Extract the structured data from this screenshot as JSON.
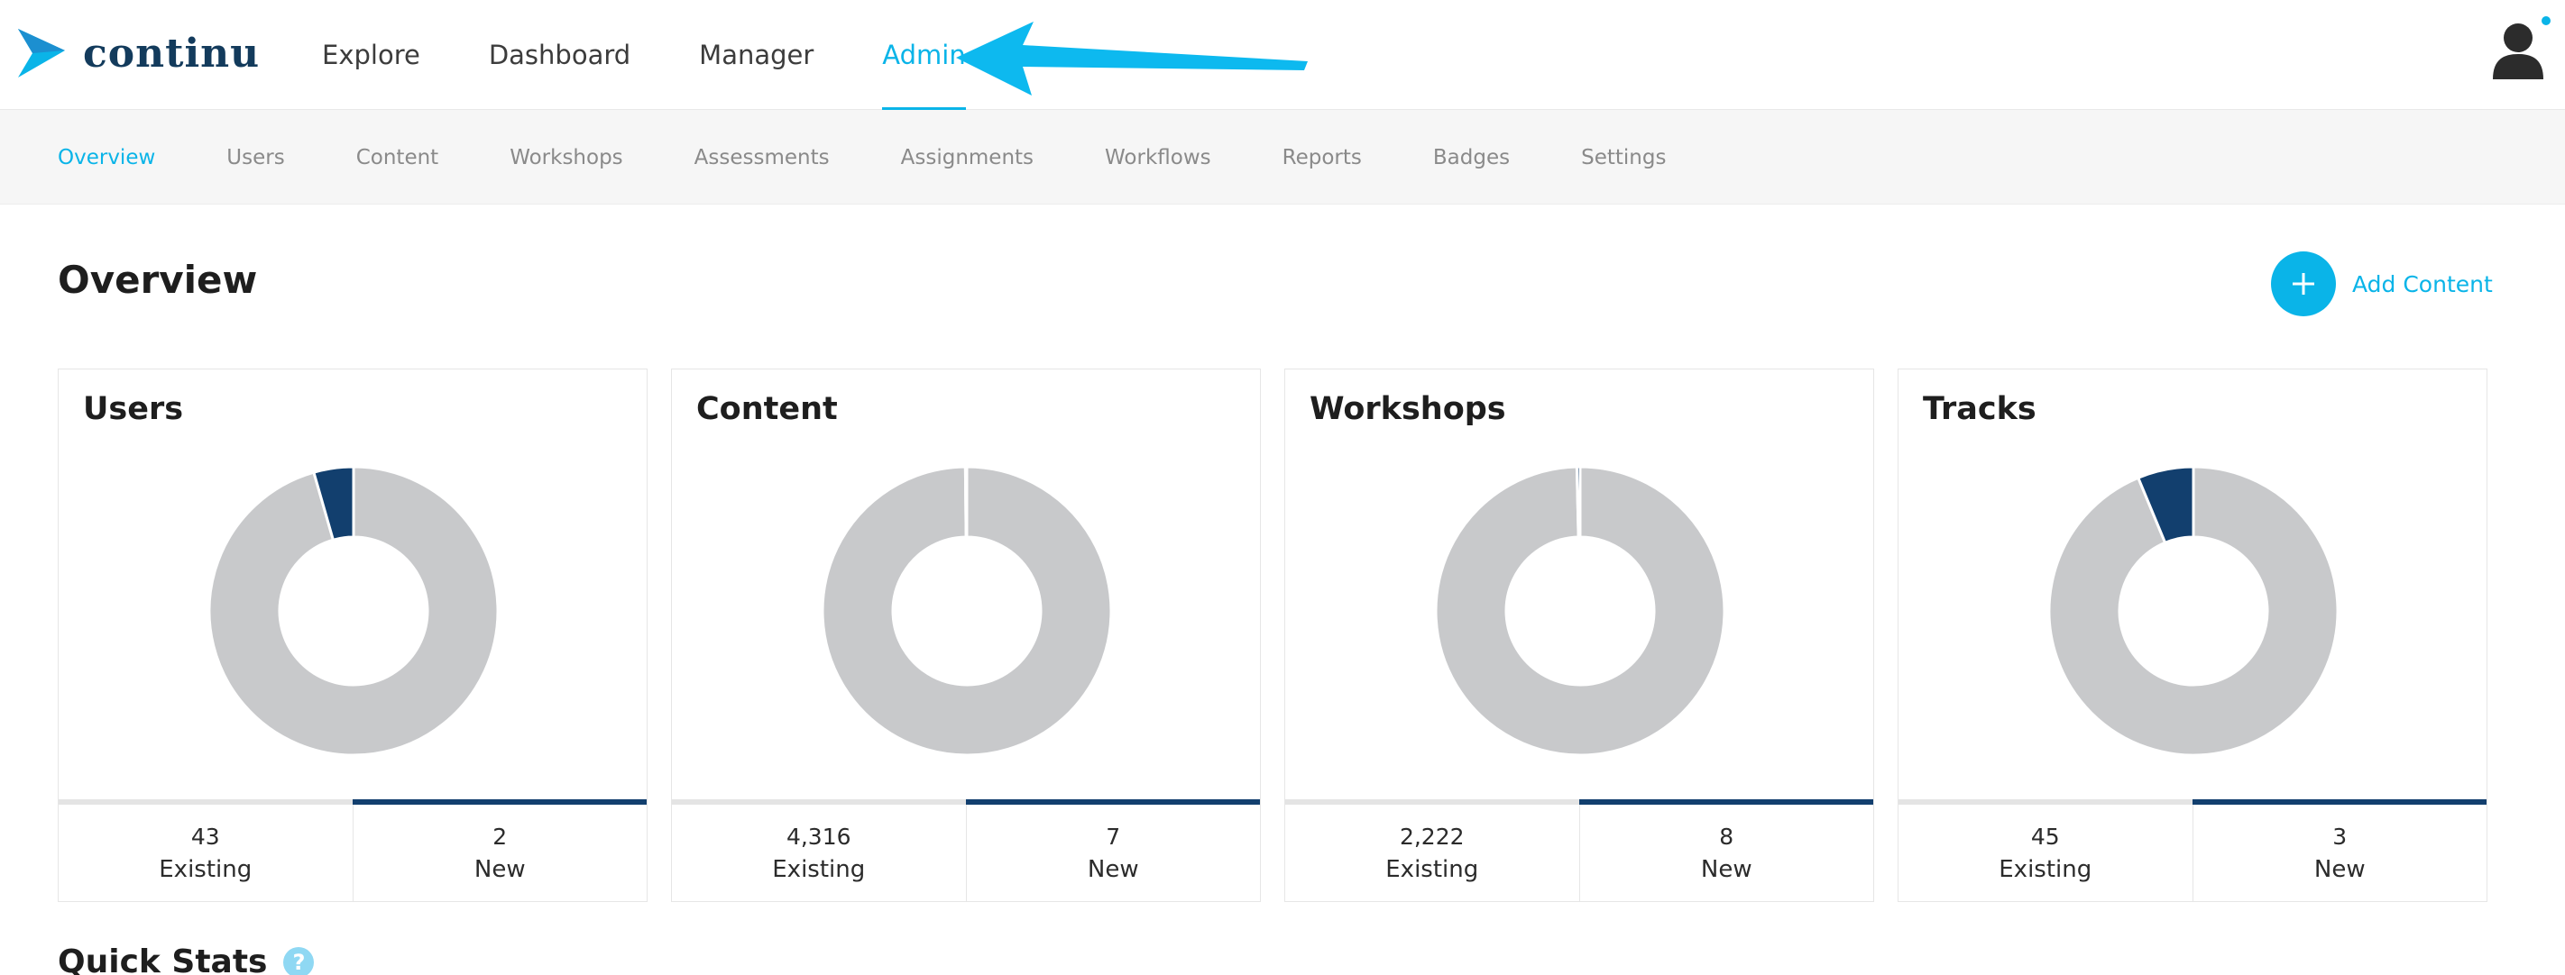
{
  "brand": {
    "name": "continu",
    "color": "#133b5c",
    "accent": "#0ab4e8"
  },
  "topnav": {
    "items": [
      {
        "label": "Explore",
        "active": false
      },
      {
        "label": "Dashboard",
        "active": false
      },
      {
        "label": "Manager",
        "active": false
      },
      {
        "label": "Admin",
        "active": true
      }
    ]
  },
  "subnav": {
    "items": [
      {
        "label": "Overview",
        "active": true
      },
      {
        "label": "Users",
        "active": false
      },
      {
        "label": "Content",
        "active": false
      },
      {
        "label": "Workshops",
        "active": false
      },
      {
        "label": "Assessments",
        "active": false
      },
      {
        "label": "Assignments",
        "active": false
      },
      {
        "label": "Workflows",
        "active": false
      },
      {
        "label": "Reports",
        "active": false
      },
      {
        "label": "Badges",
        "active": false
      },
      {
        "label": "Settings",
        "active": false
      }
    ]
  },
  "page": {
    "title": "Overview",
    "add_content_label": "Add Content"
  },
  "cards": [
    {
      "title": "Users",
      "existing_value": "43",
      "existing_label": "Existing",
      "new_value": "2",
      "new_label": "New",
      "existing": 43,
      "new": 2
    },
    {
      "title": "Content",
      "existing_value": "4,316",
      "existing_label": "Existing",
      "new_value": "7",
      "new_label": "New",
      "existing": 4316,
      "new": 7
    },
    {
      "title": "Workshops",
      "existing_value": "2,222",
      "existing_label": "Existing",
      "new_value": "8",
      "new_label": "New",
      "existing": 2222,
      "new": 8
    },
    {
      "title": "Tracks",
      "existing_value": "45",
      "existing_label": "Existing",
      "new_value": "3",
      "new_label": "New",
      "existing": 45,
      "new": 3
    }
  ],
  "chart_colors": {
    "existing": "#c8c9cb",
    "new": "#123f6e"
  },
  "quick_stats": {
    "title": "Quick Stats",
    "help_glyph": "?"
  },
  "icons": {
    "logo": "continu-arrow-logo-icon",
    "avatar": "user-avatar-icon",
    "add": "plus-icon",
    "help": "question-mark-icon",
    "annotation": "pointer-arrow-icon"
  }
}
